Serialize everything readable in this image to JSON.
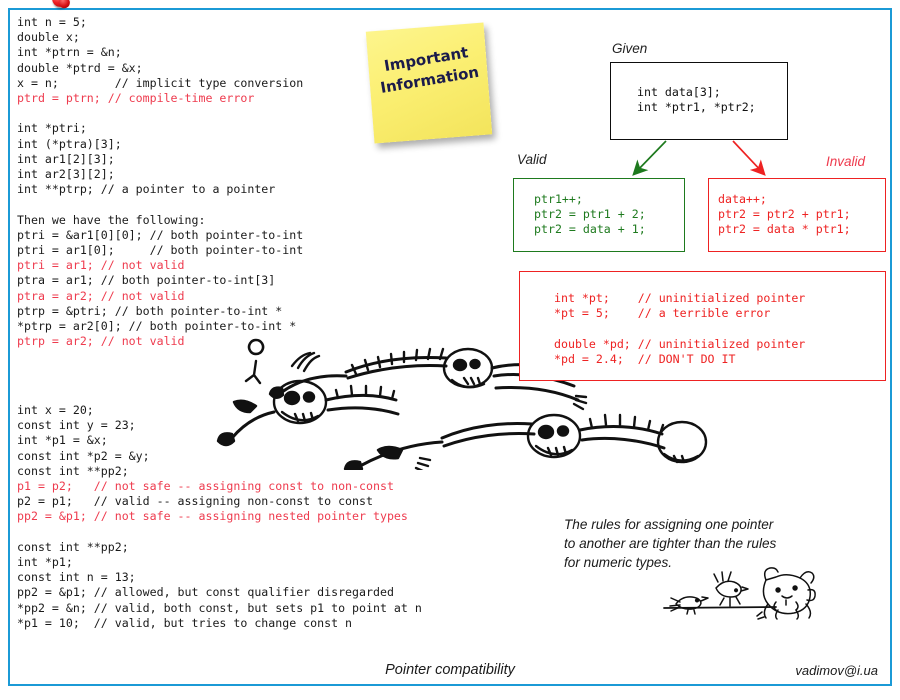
{
  "slide": {
    "border_color": "#1b9ad6",
    "footer_title": "Pointer compatibility",
    "footer_email": "vadimov@i.ua"
  },
  "colors": {
    "code_normal": "#1a1a1a",
    "code_error": "#ee3b4e",
    "valid_green": "#1e7a1e",
    "invalid_red": "#ee2222",
    "frame_blue": "#1b9ad6",
    "sticky_yellow": "#fbef72",
    "pin_red": "#ee1d22"
  },
  "sticky_note": {
    "line1": "Important",
    "line2": "Information",
    "pin_icon": "pushpin-icon"
  },
  "code_main": [
    {
      "text": "int n = 5;",
      "style": "normal"
    },
    {
      "text": "double x;",
      "style": "normal"
    },
    {
      "text": "int *ptrn = &n;",
      "style": "normal"
    },
    {
      "text": "double *ptrd = &x;",
      "style": "normal"
    },
    {
      "text": "x = n;        // implicit type conversion",
      "style": "normal"
    },
    {
      "text": "ptrd = ptrn; // compile-time error",
      "style": "error"
    },
    {
      "text": "",
      "style": "blank"
    },
    {
      "text": "int *ptri;",
      "style": "normal"
    },
    {
      "text": "int (*ptra)[3];",
      "style": "normal"
    },
    {
      "text": "int ar1[2][3];",
      "style": "normal"
    },
    {
      "text": "int ar2[3][2];",
      "style": "normal"
    },
    {
      "text": "int **ptrp; // a pointer to a pointer",
      "style": "normal"
    },
    {
      "text": "",
      "style": "blank"
    },
    {
      "text": "Then we have the following:",
      "style": "normal"
    },
    {
      "text": "ptri = &ar1[0][0]; // both pointer-to-int",
      "style": "normal"
    },
    {
      "text": "ptri = ar1[0];     // both pointer-to-int",
      "style": "normal"
    },
    {
      "text": "ptri = ar1; // not valid",
      "style": "error"
    },
    {
      "text": "ptra = ar1; // both pointer-to-int[3]",
      "style": "normal"
    },
    {
      "text": "ptra = ar2; // not valid",
      "style": "error"
    },
    {
      "text": "ptrp = &ptri; // both pointer-to-int *",
      "style": "normal"
    },
    {
      "text": "*ptrp = ar2[0]; // both pointer-to-int *",
      "style": "normal"
    },
    {
      "text": "ptrp = ar2; // not valid",
      "style": "error"
    }
  ],
  "code_const": [
    {
      "text": "int x = 20;",
      "style": "normal"
    },
    {
      "text": "const int y = 23;",
      "style": "normal"
    },
    {
      "text": "int *p1 = &x;",
      "style": "normal"
    },
    {
      "text": "const int *p2 = &y;",
      "style": "normal"
    },
    {
      "text": "const int **pp2;",
      "style": "normal"
    },
    {
      "text": "p1 = p2;   // not safe -- assigning const to non-const",
      "style": "error"
    },
    {
      "text": "p2 = p1;   // valid -- assigning non-const to const",
      "style": "normal"
    },
    {
      "text": "pp2 = &p1; // not safe -- assigning nested pointer types",
      "style": "error"
    },
    {
      "text": "",
      "style": "blank"
    },
    {
      "text": "const int **pp2;",
      "style": "normal"
    },
    {
      "text": "int *p1;",
      "style": "normal"
    },
    {
      "text": "const int n = 13;",
      "style": "normal"
    },
    {
      "text": "pp2 = &p1; // allowed, but const qualifier disregarded",
      "style": "normal"
    },
    {
      "text": "*pp2 = &n; // valid, both const, but sets p1 to point at n",
      "style": "normal"
    },
    {
      "text": "*p1 = 10;  // valid, but tries to change const n",
      "style": "normal"
    }
  ],
  "given": {
    "label": "Given",
    "code": "int data[3];\nint *ptr1, *ptr2;"
  },
  "valid": {
    "label": "Valid",
    "code": "ptr1++;\nptr2 = ptr1 + 2;\nptr2 = data + 1;"
  },
  "invalid": {
    "label": "Invalid",
    "code": "data++;\nptr2 = ptr2 + ptr1;\nptr2 = data * ptr1;"
  },
  "uninitialized": {
    "code": "int *pt;    // uninitialized pointer\n*pt = 5;    // a terrible error\n\ndouble *pd; // uninitialized pointer\n*pd = 2.4;  // DON'T DO IT"
  },
  "rules_note": {
    "line1": "The rules for assigning one pointer",
    "line2": "to another are tighter than the rules",
    "line3": "for numeric types."
  },
  "illustrations": {
    "skeletons": "skeletons-drawing",
    "dog_and_birds": "dog-and-birds-drawing"
  }
}
